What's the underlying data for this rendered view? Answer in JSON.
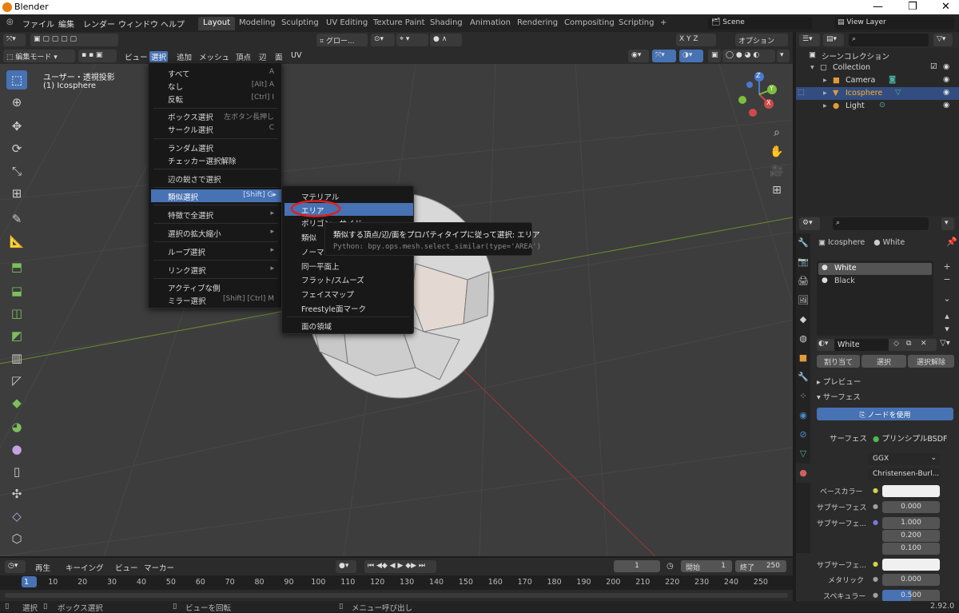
{
  "window": {
    "title": "Blender",
    "minimize": "—",
    "maximize": "❐",
    "close": "✕"
  },
  "topmenu": [
    "ファイル",
    "編集",
    "レンダー",
    "ウィンドウ",
    "ヘルプ"
  ],
  "workspaces": [
    "Layout",
    "Modeling",
    "Sculpting",
    "UV Editing",
    "Texture Paint",
    "Shading",
    "Animation",
    "Rendering",
    "Compositing",
    "Scripting"
  ],
  "add_ws": "+",
  "scene": "Scene",
  "view_layer": "View Layer",
  "header": {
    "transform": "グロー...",
    "options": "オプション",
    "mode": "編集モード",
    "menus": [
      "ビュー",
      "選択",
      "追加",
      "メッシュ",
      "頂点",
      "辺",
      "面",
      "UV"
    ]
  },
  "overlay": {
    "view": "ユーザー・透視投影",
    "object": "(1) Icosphere"
  },
  "gizmo": {
    "x": "X",
    "y": "Y",
    "z": "Z"
  },
  "select_menu": [
    {
      "label": "すべて",
      "shortcut": "A"
    },
    {
      "label": "なし",
      "shortcut": "[Alt] A"
    },
    {
      "label": "反転",
      "shortcut": "[Ctrl] I"
    },
    {
      "label": "ボックス選択",
      "shortcut": "左ボタン長押し"
    },
    {
      "label": "サークル選択",
      "shortcut": "C"
    },
    {
      "label": "ランダム選択",
      "shortcut": ""
    },
    {
      "label": "チェッカー選択解除",
      "shortcut": ""
    },
    {
      "label": "辺の鋭さで選択",
      "shortcut": ""
    },
    {
      "label": "類似選択",
      "shortcut": "[Shift] G▸"
    },
    {
      "label": "特徴で全選択",
      "shortcut": "▸"
    },
    {
      "label": "選択の拡大縮小",
      "shortcut": "▸"
    },
    {
      "label": "ループ選択",
      "shortcut": "▸"
    },
    {
      "label": "リンク選択",
      "shortcut": "▸"
    },
    {
      "label": "アクティブな側",
      "shortcut": ""
    },
    {
      "label": "ミラー選択",
      "shortcut": "[Shift] [Ctrl] M"
    }
  ],
  "similar_menu": [
    "マテリアル",
    "エリア",
    "ポリゴン・サイド",
    "類似",
    "ノーマル",
    "同一平面上",
    "フラット/スムーズ",
    "フェイスマップ",
    "Freestyle面マーク",
    "面の領域"
  ],
  "tooltip": {
    "title": "類似する頂点/辺/面をプロパティタイプに従って選択: エリア",
    "python": "Python: bpy.ops.mesh.select_similar(type='AREA')"
  },
  "outliner": {
    "scene_collection": "シーンコレクション",
    "items": [
      "Collection",
      "Camera",
      "Icosphere",
      "Light"
    ]
  },
  "properties": {
    "object": "Icosphere",
    "material": "White",
    "slots": [
      "White",
      "Black"
    ],
    "mat_field": "White",
    "buttons": [
      "割り当て",
      "選択",
      "選択解除"
    ],
    "preview": "プレビュー",
    "surface": "サーフェス",
    "use_nodes": "ノードを使用",
    "surface_label": "サーフェス",
    "bsdf": "プリンシプルBSDF",
    "dist": "GGX",
    "sss": "Christensen-Burl...",
    "rows": [
      {
        "label": "ベースカラー",
        "value": ""
      },
      {
        "label": "サブサーフェス",
        "value": "0.000"
      },
      {
        "label": "サブサーフェ...",
        "value": "1.000"
      },
      {
        "label": "",
        "value": "0.200"
      },
      {
        "label": "",
        "value": "0.100"
      },
      {
        "label": "サブサーフェ...",
        "value": ""
      },
      {
        "label": "メタリック",
        "value": "0.000"
      },
      {
        "label": "スペキュラー",
        "value": "0.500"
      }
    ]
  },
  "timeline": {
    "menus": [
      "再生",
      "キーイング",
      "ビュー",
      "マーカー"
    ],
    "current": "1",
    "start_label": "開始",
    "start": "1",
    "end_label": "終了",
    "end": "250",
    "ticks": [
      "1",
      "10",
      "20",
      "30",
      "40",
      "50",
      "60",
      "70",
      "80",
      "90",
      "100",
      "110",
      "120",
      "130",
      "140",
      "150",
      "160",
      "170",
      "180",
      "190",
      "200",
      "210",
      "220",
      "230",
      "240",
      "250"
    ]
  },
  "statusbar": {
    "items": [
      "選択",
      "ボックス選択",
      "ビューを回転",
      "メニュー呼び出し"
    ],
    "version": "2.92.0"
  }
}
